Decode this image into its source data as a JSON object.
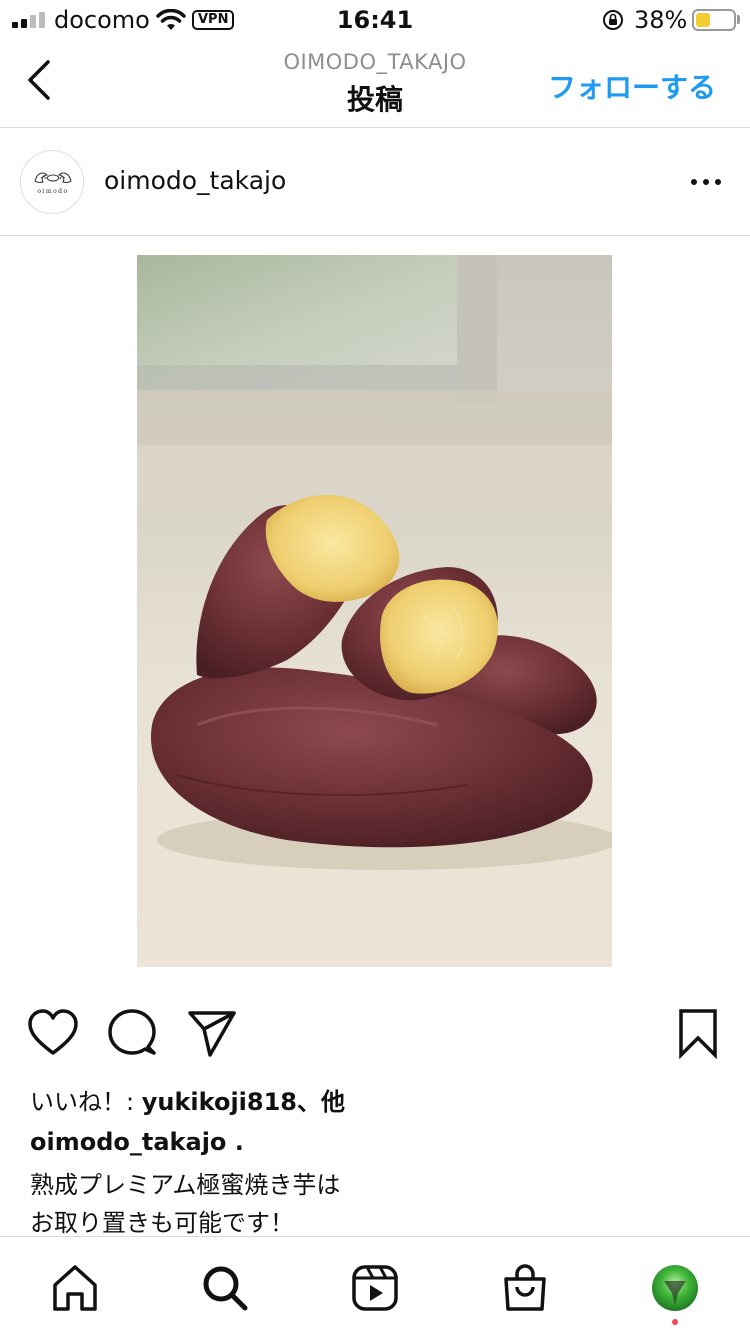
{
  "status_bar": {
    "carrier": "docomo",
    "vpn_label": "VPN",
    "time": "16:41",
    "battery_percent_text": "38%",
    "battery_level": 0.38,
    "battery_color": "#f4cc33"
  },
  "nav": {
    "subtitle": "OIMODO_TAKAJO",
    "title": "投稿",
    "follow_label": "フォローする",
    "follow_color": "#1e9bf0"
  },
  "post": {
    "username": "oimodo_takajo",
    "avatar_text": "oimodo",
    "likes_prefix": "いいね！: ",
    "likes_user": "yukikoji818",
    "likes_suffix": "、他",
    "caption_user": "oimodo_takajo",
    "caption_trail": " .",
    "caption_line1": "熟成プレミアム極蜜焼き芋は",
    "caption_line2": "お取り置きも可能です！"
  },
  "icons": {
    "actions": [
      "heart-icon",
      "comment-icon",
      "share-icon",
      "bookmark-icon"
    ],
    "tabs": [
      "home-icon",
      "search-icon",
      "reels-icon",
      "shop-icon",
      "profile-avatar"
    ]
  }
}
